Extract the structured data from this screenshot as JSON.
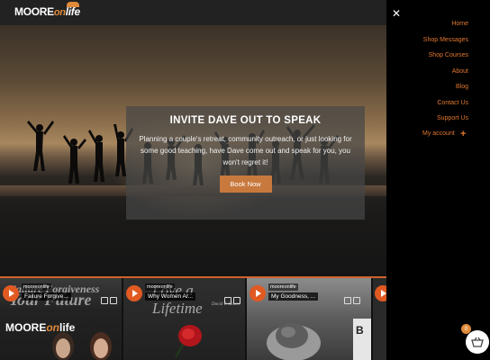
{
  "brand": {
    "logo_moore": "MOORE",
    "logo_on": "on",
    "logo_life": "life",
    "accent": "#e0772f"
  },
  "hero": {
    "title": "INVITE DAVE OUT TO SPEAK",
    "text": "Planning a couple's retreat, community outreach, or just looking for some good teaching, have Dave come out and speak for you, you won't regret it!",
    "button": "Book Now"
  },
  "menu": {
    "close_icon": "close-icon",
    "items": [
      {
        "label": "Home"
      },
      {
        "label": "Shop Messages"
      },
      {
        "label": "Shop Courses"
      },
      {
        "label": "About"
      },
      {
        "label": "Blog"
      },
      {
        "label": "Contact Us"
      },
      {
        "label": "Support Us"
      }
    ],
    "account": "My account",
    "account_plus": "+"
  },
  "videos": [
    {
      "channel": "mooreonlife",
      "title": "Failure Forgive...",
      "bg_line1": "Failure Forgiveness",
      "bg_line2": "Your Future"
    },
    {
      "channel": "mooreonlife",
      "title": "Why Women Ar...",
      "bg_big": "Love a Lifetime",
      "author": "David T. Moore"
    },
    {
      "channel": "mooreonlife",
      "title": "My Goodness, ..."
    }
  ],
  "cart": {
    "count": "0",
    "icon": "basket-icon"
  }
}
